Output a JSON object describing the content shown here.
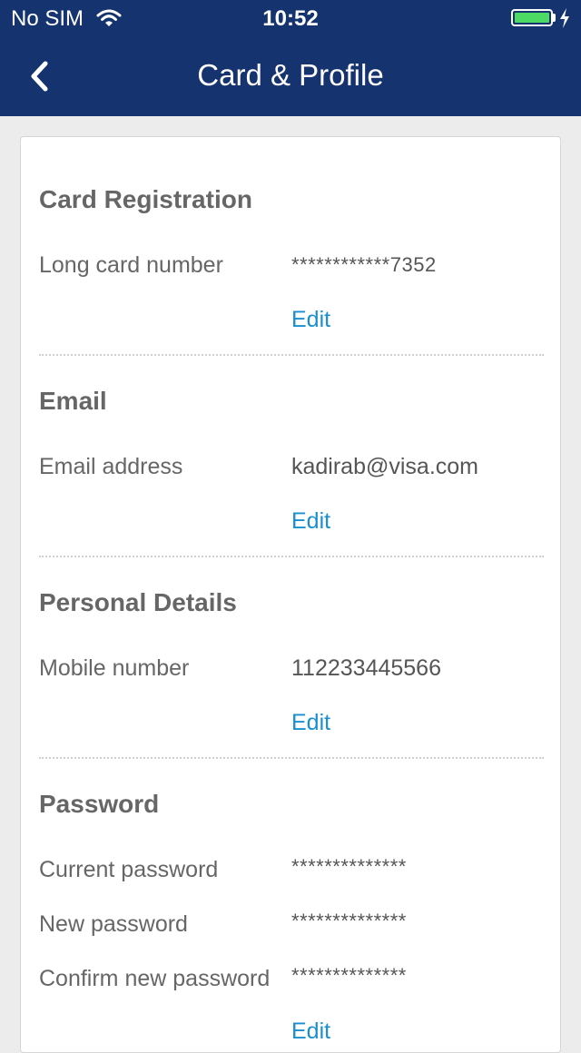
{
  "status_bar": {
    "carrier": "No SIM",
    "time": "10:52",
    "battery_level": 1.0,
    "battery_color": "#4cd964"
  },
  "nav": {
    "title": "Card & Profile",
    "back_icon": "chevron-left-icon"
  },
  "sections": {
    "card_registration": {
      "title": "Card Registration",
      "long_card_number_label": "Long card number",
      "long_card_number_value": "************7352",
      "edit_label": "Edit"
    },
    "email": {
      "title": "Email",
      "email_address_label": "Email address",
      "email_address_value": "kadirab@visa.com",
      "edit_label": "Edit"
    },
    "personal_details": {
      "title": "Personal Details",
      "mobile_number_label": "Mobile number",
      "mobile_number_value": "112233445566",
      "edit_label": "Edit"
    },
    "password": {
      "title": "Password",
      "current_password_label": "Current password",
      "current_password_value": "**************",
      "new_password_label": "New password",
      "new_password_value": "**************",
      "confirm_new_password_label": "Confirm new password",
      "confirm_new_password_value": "**************",
      "edit_label": "Edit"
    }
  },
  "colors": {
    "nav_background": "#15336e",
    "link": "#1a8fd0",
    "text": "#666666"
  }
}
